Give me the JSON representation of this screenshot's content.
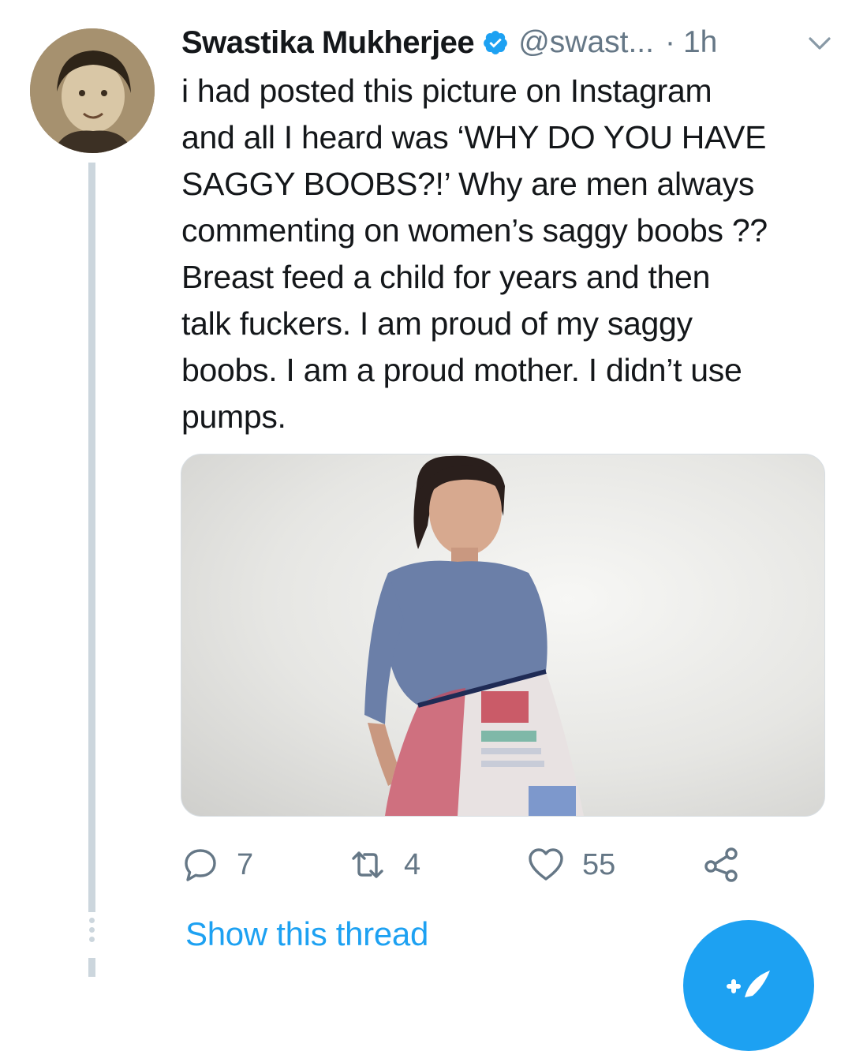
{
  "tweet": {
    "author_name": "Swastika Mukherjee",
    "handle": "@swast...",
    "separator": "·",
    "time": "1h",
    "text": "i had posted this picture on Instagram\nand all I heard was ‘WHY DO YOU HAVE\nSAGGY BOOBS?!’ Why are men always\ncommenting on women’s saggy boobs ??\nBreast feed a child for years and then\ntalk fuckers. I am proud of my saggy\nboobs. I am a proud mother. I didn’t use\npumps.",
    "verified": true
  },
  "actions": {
    "reply_count": "7",
    "retweet_count": "4",
    "like_count": "55"
  },
  "thread": {
    "show_label": "Show this thread"
  },
  "icons": {
    "verified": "verified-badge-icon",
    "caret": "chevron-down-icon",
    "reply": "reply-icon",
    "retweet": "retweet-icon",
    "like": "heart-icon",
    "share": "share-icon",
    "compose": "compose-tweet-icon"
  },
  "colors": {
    "accent": "#1da1f2",
    "text": "#14171a",
    "secondary": "#657786",
    "thread_line": "#ccd6dd"
  }
}
